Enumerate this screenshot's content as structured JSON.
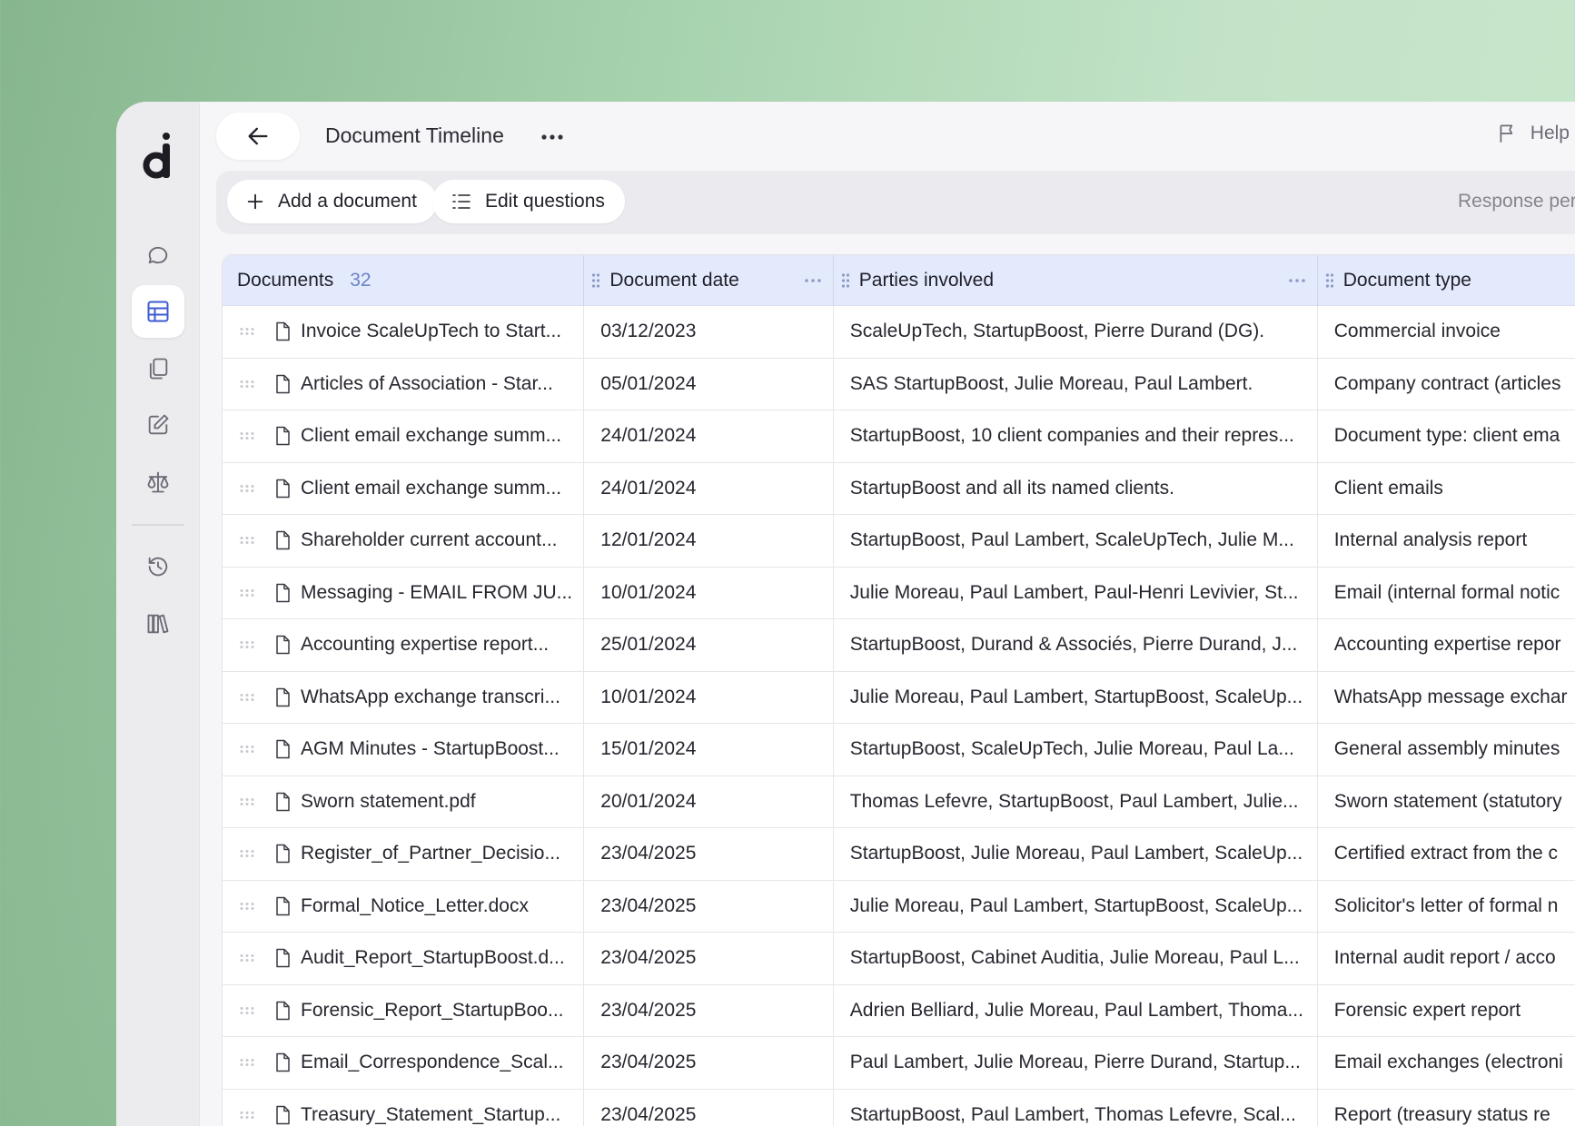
{
  "app": {
    "title": "Document Timeline",
    "help_label": "Help"
  },
  "toolbar": {
    "add_document": "Add a document",
    "edit_questions": "Edit questions",
    "response_label": "Response per d"
  },
  "rail": {
    "items": [
      "chat-icon",
      "table-icon",
      "documents-icon",
      "edit-icon",
      "scale-icon",
      "history-icon",
      "library-icon"
    ],
    "active": "table-icon"
  },
  "table": {
    "headers": {
      "documents": "Documents",
      "count": "32",
      "date": "Document date",
      "parties": "Parties involved",
      "type": "Document type"
    },
    "rows": [
      {
        "name": "Invoice ScaleUpTech to Start...",
        "date": "03/12/2023",
        "parties": "ScaleUpTech, StartupBoost, Pierre Durand (DG).",
        "type": "Commercial invoice"
      },
      {
        "name": "Articles of Association - Star...",
        "date": "05/01/2024",
        "parties": "SAS StartupBoost, Julie Moreau, Paul Lambert.",
        "type": "Company contract (articles"
      },
      {
        "name": "Client email exchange summ...",
        "date": "24/01/2024",
        "parties": "StartupBoost, 10 client companies and their repres...",
        "type": "Document type: client ema"
      },
      {
        "name": "Client email exchange summ...",
        "date": "24/01/2024",
        "parties": "StartupBoost and all its named clients.",
        "type": "Client emails"
      },
      {
        "name": "Shareholder current account...",
        "date": "12/01/2024",
        "parties": "StartupBoost, Paul Lambert, ScaleUpTech, Julie M...",
        "type": "Internal analysis report"
      },
      {
        "name": "Messaging - EMAIL FROM JU...",
        "date": "10/01/2024",
        "parties": "Julie Moreau, Paul Lambert, Paul-Henri Levivier, St...",
        "type": "Email (internal formal notic"
      },
      {
        "name": "Accounting expertise report...",
        "date": "25/01/2024",
        "parties": "StartupBoost, Durand & Associés, Pierre Durand, J...",
        "type": "Accounting expertise repor"
      },
      {
        "name": "WhatsApp exchange transcri...",
        "date": "10/01/2024",
        "parties": "Julie Moreau, Paul Lambert, StartupBoost, ScaleUp...",
        "type": "WhatsApp message exchar"
      },
      {
        "name": "AGM Minutes - StartupBoost...",
        "date": "15/01/2024",
        "parties": "StartupBoost, ScaleUpTech, Julie Moreau, Paul La...",
        "type": "General assembly minutes"
      },
      {
        "name": "Sworn statement.pdf",
        "date": "20/01/2024",
        "parties": "Thomas Lefevre, StartupBoost, Paul Lambert, Julie...",
        "type": "Sworn statement (statutory"
      },
      {
        "name": "Register_of_Partner_Decisio...",
        "date": "23/04/2025",
        "parties": "StartupBoost, Julie Moreau, Paul Lambert, ScaleUp...",
        "type": "Certified extract from the c"
      },
      {
        "name": "Formal_Notice_Letter.docx",
        "date": "23/04/2025",
        "parties": "Julie Moreau, Paul Lambert, StartupBoost, ScaleUp...",
        "type": "Solicitor's letter of formal n"
      },
      {
        "name": "Audit_Report_StartupBoost.d...",
        "date": "23/04/2025",
        "parties": "StartupBoost, Cabinet Auditia, Julie Moreau, Paul L...",
        "type": "Internal audit report / acco"
      },
      {
        "name": "Forensic_Report_StartupBoo...",
        "date": "23/04/2025",
        "parties": "Adrien Belliard, Julie Moreau, Paul Lambert, Thoma...",
        "type": "Forensic expert report"
      },
      {
        "name": "Email_Correspondence_Scal...",
        "date": "23/04/2025",
        "parties": "Paul Lambert, Julie Moreau, Pierre Durand, Startup...",
        "type": "Email exchanges (electroni"
      },
      {
        "name": "Treasury_Statement_Startup...",
        "date": "23/04/2025",
        "parties": "StartupBoost, Paul Lambert, Thomas Lefevre, Scal...",
        "type": "Report (treasury status re"
      }
    ]
  }
}
